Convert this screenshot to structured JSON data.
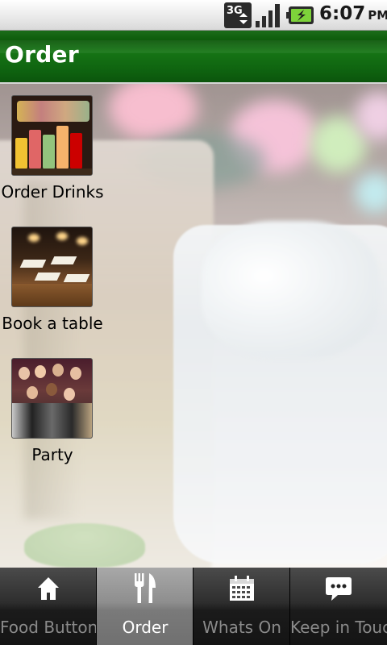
{
  "status_bar": {
    "network_type": "3G",
    "time": "6:07",
    "ampm": "PM",
    "icons": [
      "network-3g-icon",
      "signal-strength-icon",
      "battery-charging-icon"
    ]
  },
  "header": {
    "title": "Order",
    "color": "#0f6410"
  },
  "menu": {
    "items": [
      {
        "label": "Order Drinks",
        "icon": "drinks-photo"
      },
      {
        "label": "Book a table",
        "icon": "restaurant-table-photo"
      },
      {
        "label": "Party",
        "icon": "party-photo"
      }
    ]
  },
  "tabs": [
    {
      "label": "Food Buttons",
      "icon": "home-icon",
      "active": false
    },
    {
      "label": "Order",
      "icon": "fork-knife-icon",
      "active": true
    },
    {
      "label": "Whats On",
      "icon": "calendar-icon",
      "active": false
    },
    {
      "label": "Keep in Touc",
      "icon": "chat-bubble-icon",
      "active": false
    }
  ]
}
